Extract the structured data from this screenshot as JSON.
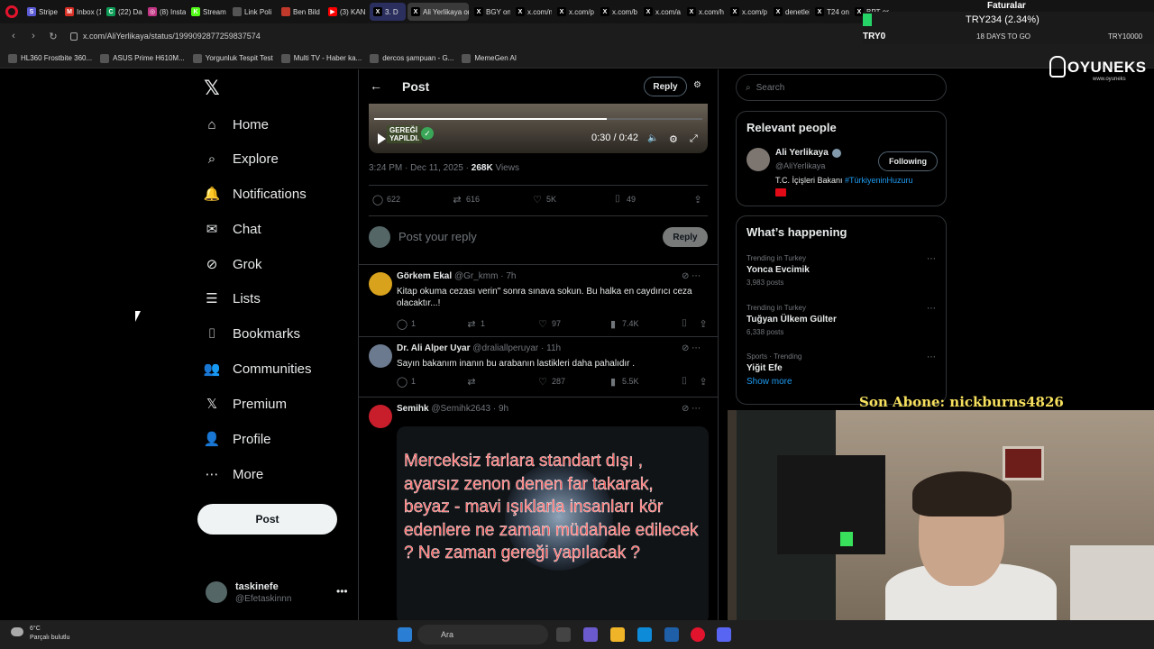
{
  "browser": {
    "tabs": [
      {
        "label": "Stripe Ex",
        "color": "#5b5bd6",
        "glyph": "S"
      },
      {
        "label": "Inbox (1",
        "color": "#d93025",
        "glyph": "M"
      },
      {
        "label": "(22) Da",
        "color": "#0f9d58",
        "glyph": "C"
      },
      {
        "label": "(8) Insta",
        "color": "#c13584",
        "glyph": "◎"
      },
      {
        "label": "Stream",
        "color": "#53fc18",
        "glyph": "K"
      },
      {
        "label": "Link Poli",
        "color": "#555555",
        "glyph": ""
      },
      {
        "label": "Ben Bild",
        "color": "#c0392b",
        "glyph": ""
      },
      {
        "label": "(3) KAN",
        "color": "#ff0000",
        "glyph": "▶"
      },
      {
        "label": "3. D",
        "color": "#000000",
        "glyph": "X"
      },
      {
        "label": "Ali Yerlikaya on",
        "color": "#000000",
        "glyph": "X"
      },
      {
        "label": "BGY on",
        "color": "#000000",
        "glyph": "X"
      },
      {
        "label": "x.com/n",
        "color": "#000000",
        "glyph": "X"
      },
      {
        "label": "x.com/p",
        "color": "#000000",
        "glyph": "X"
      },
      {
        "label": "x.com/b",
        "color": "#000000",
        "glyph": "X"
      },
      {
        "label": "x.com/a",
        "color": "#000000",
        "glyph": "X"
      },
      {
        "label": "x.com/h",
        "color": "#000000",
        "glyph": "X"
      },
      {
        "label": "x.com/p",
        "color": "#000000",
        "glyph": "X"
      },
      {
        "label": "denetlei",
        "color": "#000000",
        "glyph": "X"
      },
      {
        "label": "T24 on",
        "color": "#000000",
        "glyph": "X"
      },
      {
        "label": "BPT on",
        "color": "#000000",
        "glyph": "X"
      }
    ],
    "url": "x.com/AliYerlikaya/status/1999092877259837574",
    "bookmarks": [
      "HL360 Frostbite 360...",
      "ASUS Prime H610M...",
      "Yorgunluk Tespit Test",
      "Multi TV - Haber ka...",
      "dercos şampuan - G...",
      "MemeGen AI"
    ]
  },
  "overlay": {
    "fatura": "Faturalar",
    "ticker_pair": "TRY234 (2.34%)",
    "ticker_symbol": "TRY0",
    "ticker_days": "18 DAYS TO GO",
    "ticker_symbol2": "TRY10000",
    "brand": "OYUNEKS",
    "brand_sub": "www.oyuneks",
    "subscriber_banner": "Son Abone: nickburns4826"
  },
  "nav": {
    "items": [
      {
        "name": "home",
        "label": "Home",
        "icon": "⌂"
      },
      {
        "name": "explore",
        "label": "Explore",
        "icon": "⌕"
      },
      {
        "name": "notifications",
        "label": "Notifications",
        "icon": "🔔"
      },
      {
        "name": "chat",
        "label": "Chat",
        "icon": "✉"
      },
      {
        "name": "grok",
        "label": "Grok",
        "icon": "⊘"
      },
      {
        "name": "lists",
        "label": "Lists",
        "icon": "☰"
      },
      {
        "name": "bookmarks",
        "label": "Bookmarks",
        "icon": "⌷"
      },
      {
        "name": "communities",
        "label": "Communities",
        "icon": "👥"
      },
      {
        "name": "premium",
        "label": "Premium",
        "icon": "𝕏"
      },
      {
        "name": "profile",
        "label": "Profile",
        "icon": "👤"
      },
      {
        "name": "more",
        "label": "More",
        "icon": "⋯"
      }
    ],
    "post_button": "Post",
    "account_name": "taskinefe",
    "account_handle": "@Efetaskinnn"
  },
  "main": {
    "header_title": "Post",
    "header_reply": "Reply",
    "video_time": "0:30 / 0:42",
    "video_progress": 0.71,
    "video_badge_line1": "GEREĞİ",
    "video_badge_line2": "YAPILDI.",
    "timestamp": "3:24 PM · Dec 11, 2025 · ",
    "views_count": "268K",
    "views_label": " Views",
    "stats": {
      "replies": "622",
      "reposts": "616",
      "likes": "5K",
      "bookmarks": "49"
    },
    "composer_placeholder": "Post your reply",
    "composer_button": "Reply",
    "replies": [
      {
        "name": "Görkem Ekal",
        "handle": "@Gr_kmm",
        "time": "7h",
        "text": "Kitap okuma cezası verin\" sonra sınava sokun. Bu halka en caydırıcı ceza olacaktır...!",
        "replies": "1",
        "reposts": "1",
        "likes": "97",
        "views": "7.4K",
        "avatar_color": "#d8a21c"
      },
      {
        "name": "Dr. Ali Alper Uyar",
        "handle": "@draliallperuyar",
        "time": "11h",
        "text": "Sayın bakanım inanın bu arabanın lastikleri daha pahalıdır .",
        "replies": "1",
        "reposts": "",
        "likes": "287",
        "views": "5.5K",
        "avatar_color": "#6b7a8f"
      },
      {
        "name": "Semihk",
        "handle": "@Semihk2643",
        "time": "9h",
        "image_caption": "Merceksiz farlara standart dışı , ayarsız zenon denen far takarak, beyaz - mavi ışıklarla insanları kör edenlere ne zaman müdahale edilecek ? Ne zaman gereği yapılacak ?",
        "avatar_color": "#c81e2b"
      }
    ]
  },
  "sidebar": {
    "search_placeholder": "Search",
    "relevant_title": "Relevant people",
    "person_name": "Ali Yerlikaya",
    "person_handle": "@AliYerlikaya",
    "follow_label": "Following",
    "bio_text": "T.C. İçişleri Bakanı ",
    "bio_tag": "#TürkiyeninHuzuru",
    "happening_title": "What’s happening",
    "trends": [
      {
        "context": "Trending in Turkey",
        "title": "Yonca Evcimik",
        "count": "3,983 posts"
      },
      {
        "context": "Trending in Turkey",
        "title": "Tuğyan Ülkem Gülter",
        "count": "6,338 posts"
      },
      {
        "context": "Sports · Trending",
        "title": "Yiğit Efe",
        "count": ""
      }
    ],
    "show_more": "Show more"
  },
  "taskbar": {
    "temperature": "6°C",
    "weather": "Parçalı bulutlu",
    "search": "Ara"
  }
}
